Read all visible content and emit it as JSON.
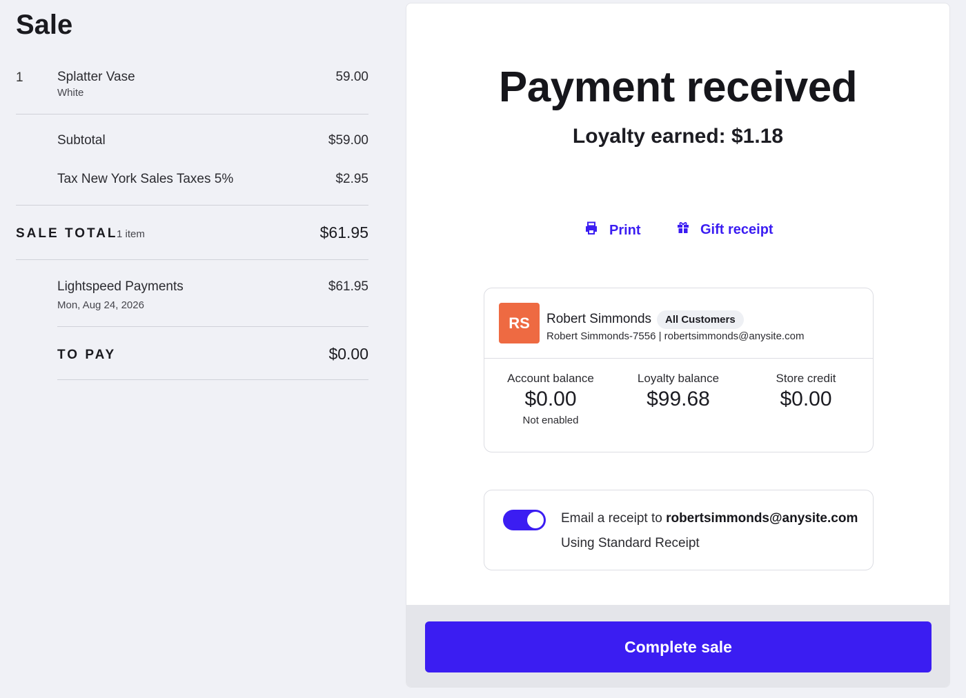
{
  "sale": {
    "title": "Sale",
    "items": [
      {
        "qty": "1",
        "name": "Splatter Vase",
        "variant": "White",
        "price": "59.00"
      }
    ],
    "subtotal": {
      "label": "Subtotal",
      "value": "$59.00"
    },
    "tax": {
      "label": "Tax New York Sales Taxes 5%",
      "value": "$2.95"
    },
    "total": {
      "label": "SALE TOTAL",
      "count": "1 item",
      "value": "$61.95"
    },
    "payment": {
      "method": "Lightspeed Payments",
      "date": "Mon, Aug 24, 2026",
      "value": "$61.95"
    },
    "to_pay": {
      "label": "TO PAY",
      "value": "$0.00"
    }
  },
  "confirmation": {
    "headline": "Payment received",
    "loyalty_earned": "Loyalty earned: $1.18",
    "print_label": "Print",
    "gift_receipt_label": "Gift receipt"
  },
  "customer": {
    "initials": "RS",
    "name": "Robert Simmonds",
    "group": "All Customers",
    "meta": "Robert Simmonds-7556 | robertsimmonds@anysite.com",
    "avatar_color": "#ee6a42",
    "balances": {
      "account": {
        "label": "Account balance",
        "value": "$0.00",
        "note": "Not enabled"
      },
      "loyalty": {
        "label": "Loyalty balance",
        "value": "$99.68"
      },
      "store_credit": {
        "label": "Store credit",
        "value": "$0.00"
      }
    }
  },
  "email_receipt": {
    "enabled": true,
    "prefix": "Email a receipt to ",
    "email": "robertsimmonds@anysite.com",
    "template": "Using Standard Receipt"
  },
  "footer": {
    "complete_label": "Complete sale"
  },
  "colors": {
    "accent": "#3b1df2",
    "avatar": "#ee6a42",
    "background": "#f0f1f6"
  },
  "icons": {
    "print": "printer-icon",
    "gift": "gift-icon"
  }
}
